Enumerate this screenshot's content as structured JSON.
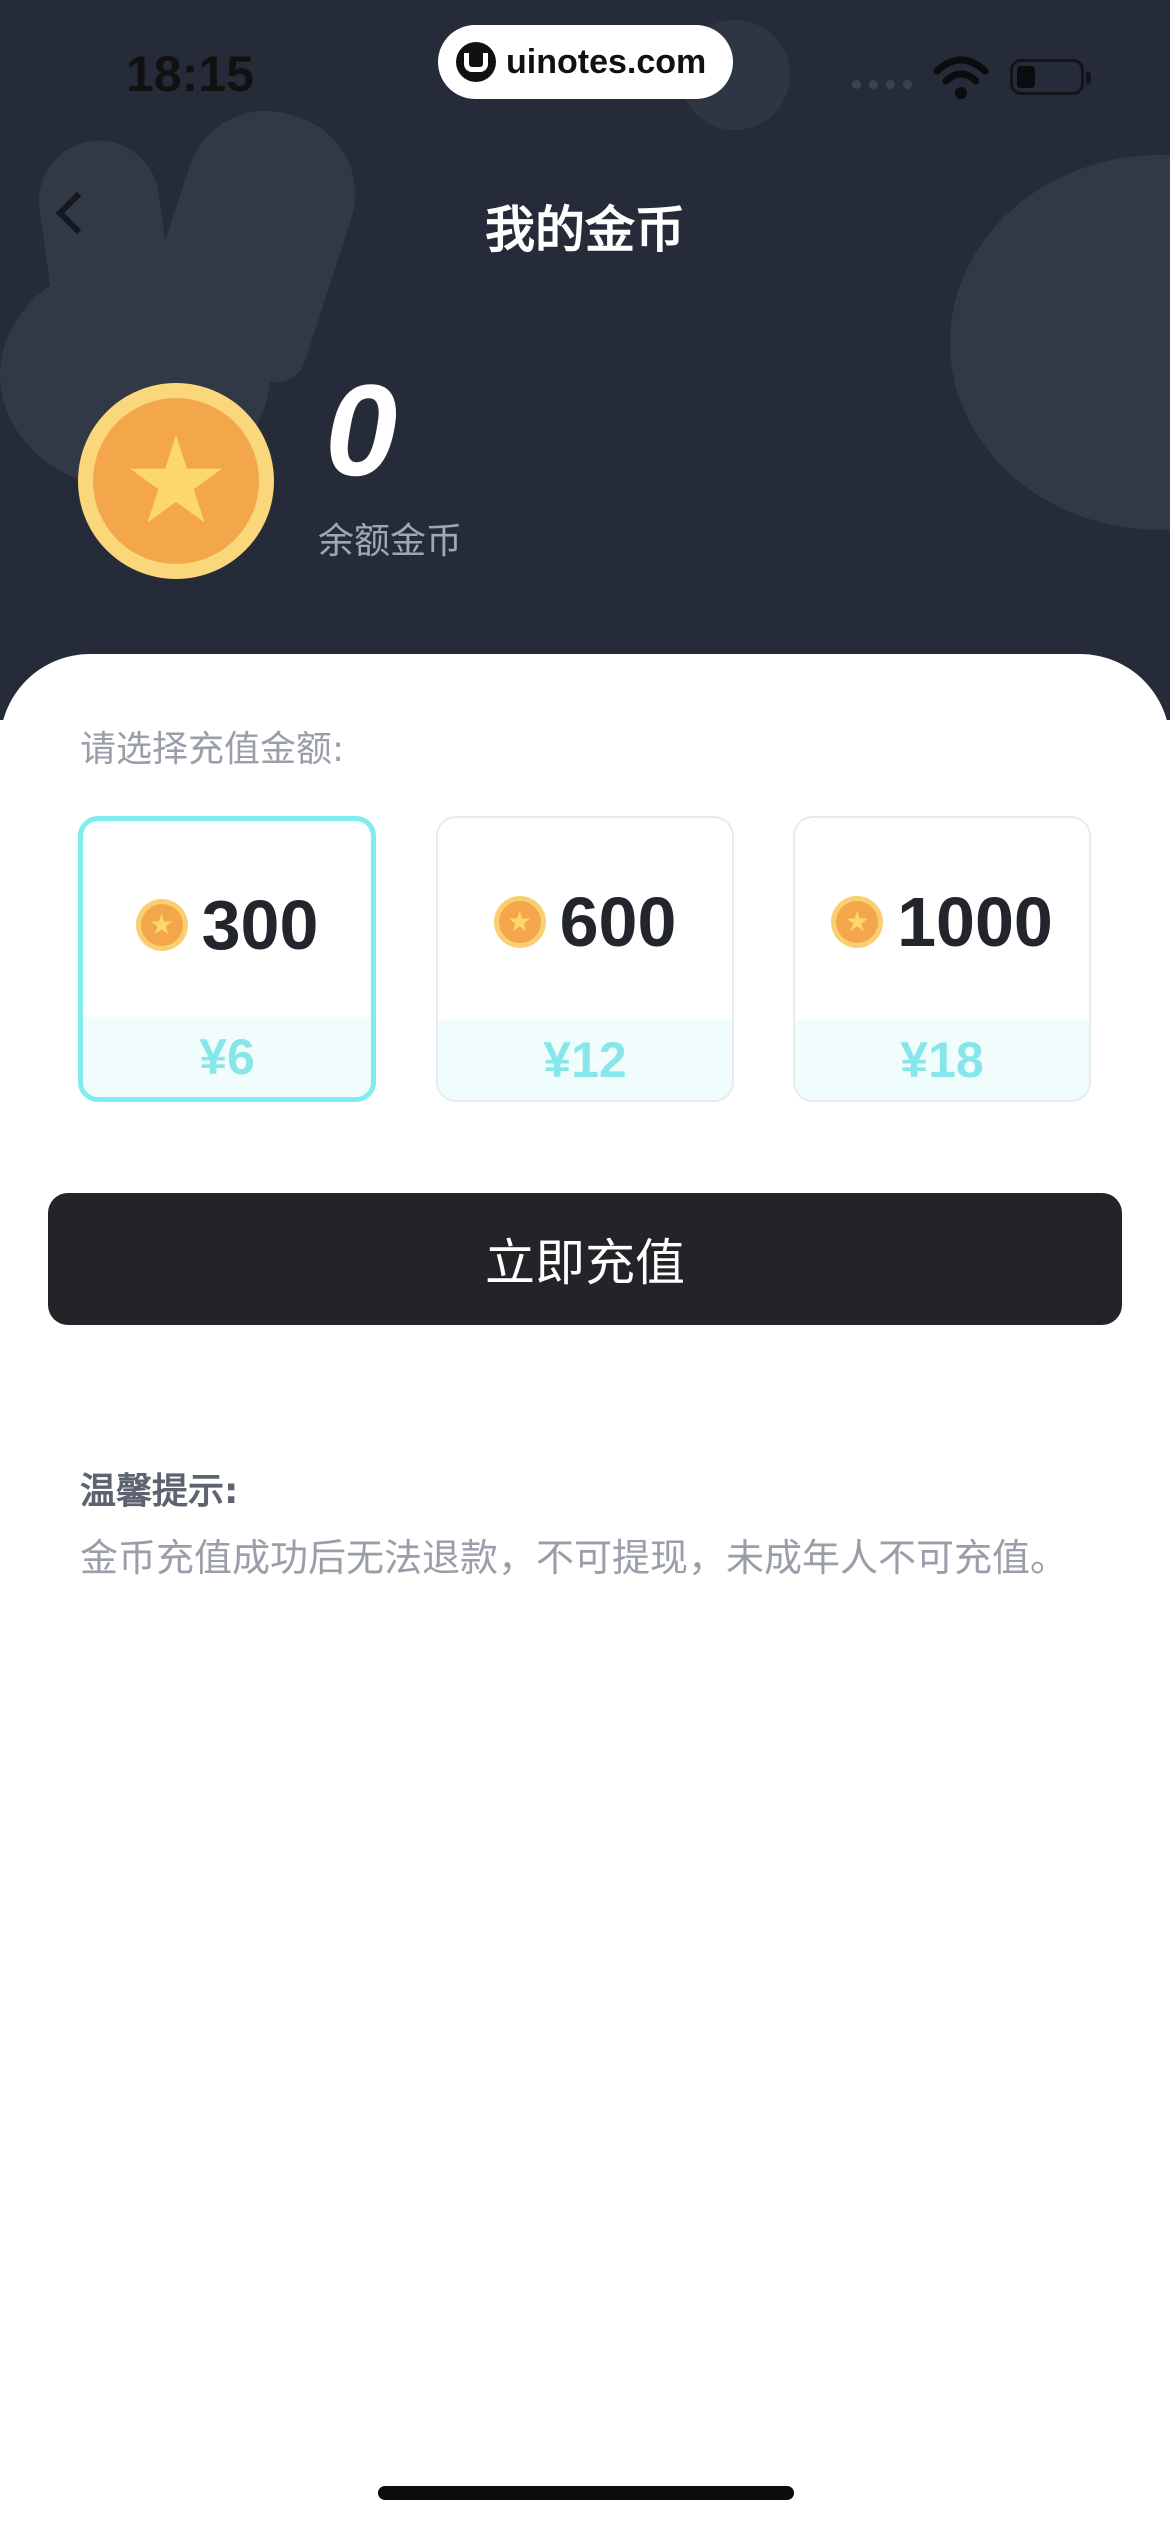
{
  "status_bar": {
    "time": "18:15",
    "watermark": "uinotes.com"
  },
  "nav": {
    "title": "我的金币",
    "back_icon": "chevron-left-icon"
  },
  "wallet": {
    "balance": "0",
    "balance_label": "余额金币"
  },
  "recharge": {
    "select_label": "请选择充值金额:",
    "packages": [
      {
        "amount": "300",
        "price": "¥6",
        "selected": true
      },
      {
        "amount": "600",
        "price": "¥12",
        "selected": false
      },
      {
        "amount": "1000",
        "price": "¥18",
        "selected": false
      }
    ],
    "button_label": "立即充值"
  },
  "notice": {
    "title": "温馨提示:",
    "text": "金币充值成功后无法退款，不可提现，未成年人不可充值。"
  },
  "colors": {
    "header_bg": "#252b38",
    "accent": "#7fecef",
    "coin": "#f3a64a",
    "button_bg": "#222428"
  }
}
